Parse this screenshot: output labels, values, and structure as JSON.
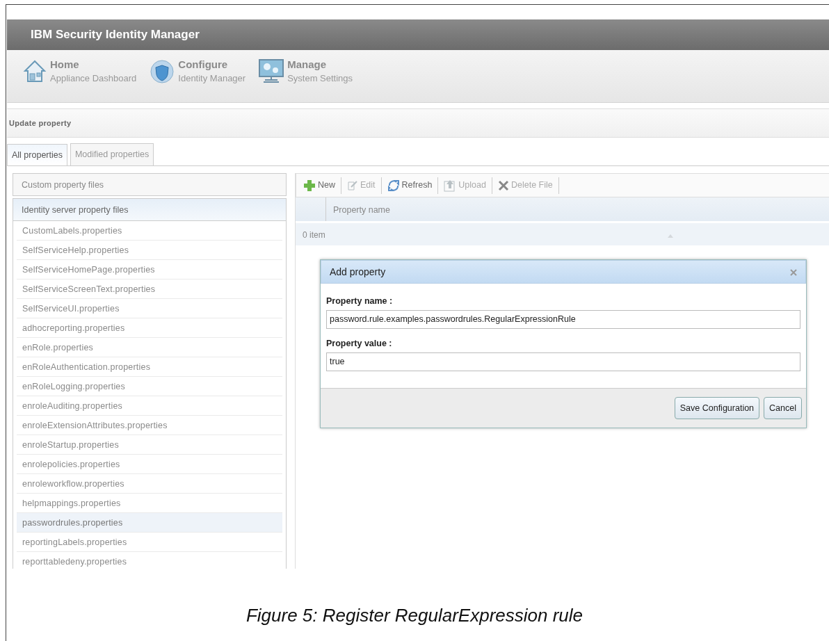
{
  "app": {
    "title": "IBM Security Identity Manager"
  },
  "nav": [
    {
      "kind": "home",
      "title": "Home",
      "subtitle": "Appliance Dashboard"
    },
    {
      "kind": "configure",
      "title": "Configure",
      "subtitle": "Identity Manager"
    },
    {
      "kind": "manage",
      "title": "Manage",
      "subtitle": "System Settings"
    }
  ],
  "breadcrumb": "Update property",
  "tabs": [
    {
      "label": "All properties",
      "selected": true
    },
    {
      "label": "Modified properties",
      "selected": false
    }
  ],
  "sections": [
    {
      "title": "Custom property files",
      "expanded": false
    },
    {
      "title": "Identity server property files",
      "expanded": true,
      "files": [
        {
          "name": "CustomLabels.properties",
          "selected": false
        },
        {
          "name": "SelfServiceHelp.properties",
          "selected": false
        },
        {
          "name": "SelfServiceHomePage.properties",
          "selected": false
        },
        {
          "name": "SelfServiceScreenText.properties",
          "selected": false
        },
        {
          "name": "SelfServiceUI.properties",
          "selected": false
        },
        {
          "name": "adhocreporting.properties",
          "selected": false
        },
        {
          "name": "enRole.properties",
          "selected": false
        },
        {
          "name": "enRoleAuthentication.properties",
          "selected": false
        },
        {
          "name": "enRoleLogging.properties",
          "selected": false
        },
        {
          "name": "enroleAuditing.properties",
          "selected": false
        },
        {
          "name": "enroleExtensionAttributes.properties",
          "selected": false
        },
        {
          "name": "enroleStartup.properties",
          "selected": false
        },
        {
          "name": "enrolepolicies.properties",
          "selected": false
        },
        {
          "name": "enroleworkflow.properties",
          "selected": false
        },
        {
          "name": "helpmappings.properties",
          "selected": false
        },
        {
          "name": "passwordrules.properties",
          "selected": true
        },
        {
          "name": "reportingLabels.properties",
          "selected": false
        },
        {
          "name": "reporttabledeny.properties",
          "selected": false
        }
      ]
    }
  ],
  "toolbar": [
    {
      "kind": "new",
      "label": "New",
      "disabled": false
    },
    {
      "kind": "edit",
      "label": "Edit",
      "disabled": true
    },
    {
      "kind": "refresh",
      "label": "Refresh",
      "disabled": false
    },
    {
      "kind": "upload",
      "label": "Upload",
      "disabled": true
    },
    {
      "kind": "delete",
      "label": "Delete File",
      "disabled": true
    }
  ],
  "table": {
    "columns": [
      "Property name"
    ],
    "footer": "0 item"
  },
  "dialog": {
    "title": "Add property",
    "fields": [
      {
        "label": "Property name :",
        "value": "password.rule.examples.passwordrules.RegularExpressionRule"
      },
      {
        "label": "Property value :",
        "value": "true"
      }
    ],
    "buttons": [
      "Save Configuration",
      "Cancel"
    ]
  },
  "caption": "Figure 5: Register RegularExpression rule"
}
